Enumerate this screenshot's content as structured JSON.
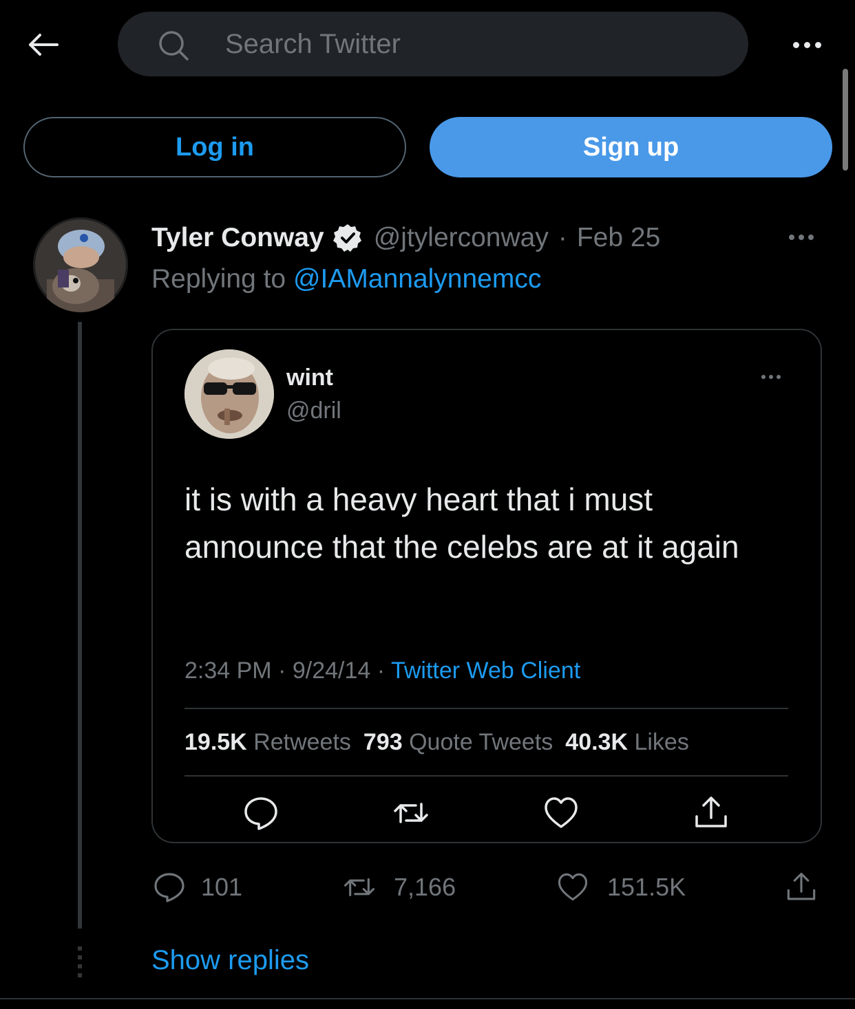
{
  "topbar": {
    "search_placeholder": "Search Twitter"
  },
  "auth": {
    "login_label": "Log in",
    "signup_label": "Sign up"
  },
  "tweet": {
    "author_name": "Tyler Conway",
    "handle": "@jtylerconway",
    "separator": "·",
    "date": "Feb 25",
    "replying_prefix": "Replying to ",
    "replying_to": "@IAMannalynnemcc",
    "actions": {
      "replies": "101",
      "retweets": "7,166",
      "likes": "151.5K"
    },
    "show_replies": "Show replies"
  },
  "quoted": {
    "name": "wint",
    "handle": "@dril",
    "text": "it is with a heavy heart that i must announce that the celebs are at it again",
    "time": "2:34 PM",
    "date": "9/24/14",
    "separator": "·",
    "client": "Twitter Web Client",
    "stats": {
      "retweets_count": "19.5K",
      "retweets_label": "Retweets",
      "quotes_count": "793",
      "quotes_label": "Quote Tweets",
      "likes_count": "40.3K",
      "likes_label": "Likes"
    }
  },
  "colors": {
    "background": "#000000",
    "accent": "#1d9bf0",
    "signup_button": "#4a99e9",
    "muted_text": "#71767b",
    "border": "#2f3336"
  }
}
